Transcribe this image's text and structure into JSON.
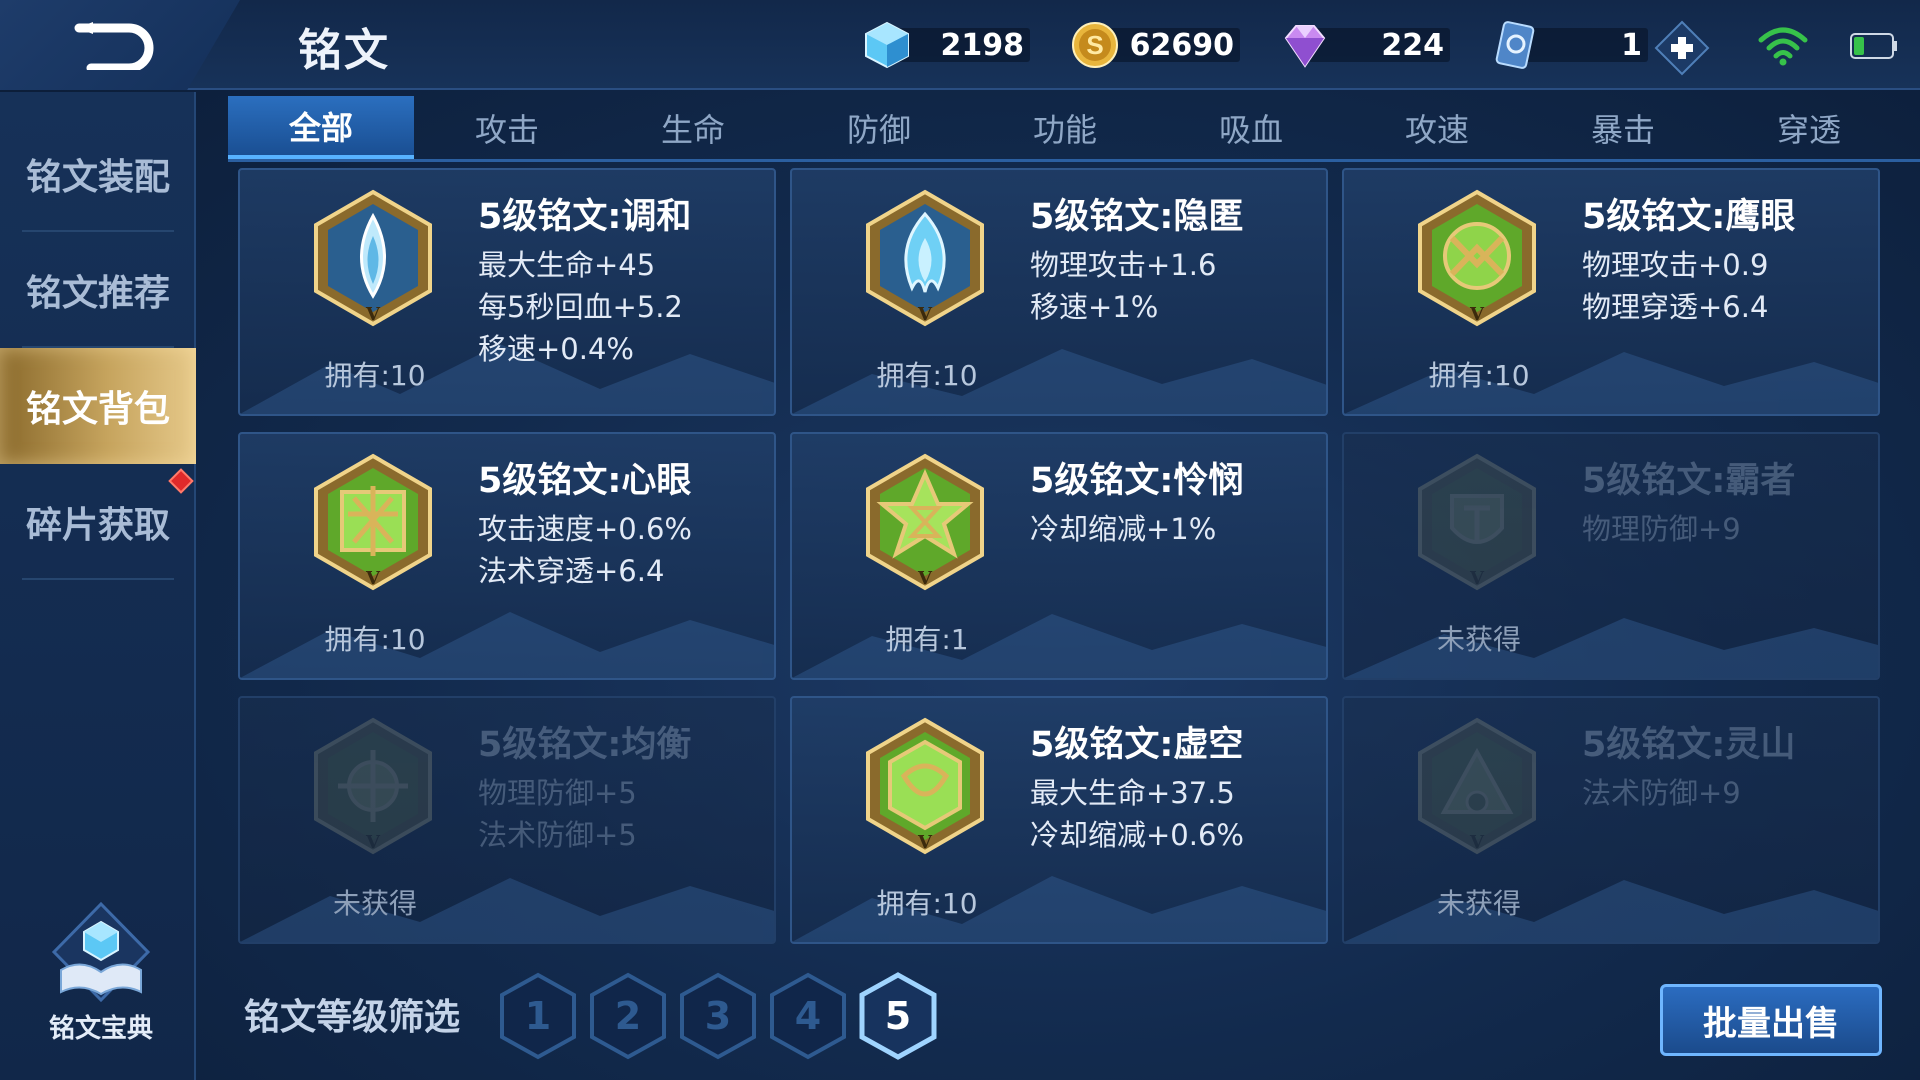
{
  "header": {
    "title": "铭文",
    "currencies": [
      {
        "name": "crystal-icon",
        "value": "2198",
        "color": "#5cc8f5"
      },
      {
        "name": "gold-coin-icon",
        "value": "62690",
        "color": "#e8b53c"
      },
      {
        "name": "diamond-icon",
        "value": "224",
        "color": "#c98af0"
      },
      {
        "name": "ticket-icon",
        "value": "1",
        "color": "#7ab0e8"
      }
    ]
  },
  "sidebar": {
    "items": [
      {
        "label": "铭文装配"
      },
      {
        "label": "铭文推荐"
      },
      {
        "label": "铭文背包",
        "active": true
      },
      {
        "label": "碎片获取"
      }
    ],
    "codex_label": "铭文宝典"
  },
  "tabs": [
    "全部",
    "攻击",
    "生命",
    "防御",
    "功能",
    "吸血",
    "攻速",
    "暴击",
    "穿透"
  ],
  "active_tab": "全部",
  "cards": [
    {
      "name": "5级铭文:调和",
      "stats": [
        "最大生命+45",
        "每5秒回血+5.2",
        "移速+0.4%"
      ],
      "owned": "拥有:10",
      "locked": false,
      "icon": "blue-drop-emblem-icon"
    },
    {
      "name": "5级铭文:隐匿",
      "stats": [
        "物理攻击+1.6",
        "移速+1%"
      ],
      "owned": "拥有:10",
      "locked": false,
      "icon": "blue-flame-emblem-icon"
    },
    {
      "name": "5级铭文:鹰眼",
      "stats": [
        "物理攻击+0.9",
        "物理穿透+6.4"
      ],
      "owned": "拥有:10",
      "locked": false,
      "icon": "green-eagle-emblem-icon"
    },
    {
      "name": "5级铭文:心眼",
      "stats": [
        "攻击速度+0.6%",
        "法术穿透+6.4"
      ],
      "owned": "拥有:10",
      "locked": false,
      "icon": "green-eye-emblem-icon"
    },
    {
      "name": "5级铭文:怜悯",
      "stats": [
        "冷却缩减+1%"
      ],
      "owned": "拥有:1",
      "locked": false,
      "icon": "green-star-emblem-icon"
    },
    {
      "name": "5级铭文:霸者",
      "stats": [
        "物理防御+9"
      ],
      "owned": "未获得",
      "locked": true,
      "icon": "green-helm-emblem-icon"
    },
    {
      "name": "5级铭文:均衡",
      "stats": [
        "物理防御+5",
        "法术防御+5"
      ],
      "owned": "未获得",
      "locked": true,
      "icon": "green-balance-emblem-icon"
    },
    {
      "name": "5级铭文:虚空",
      "stats": [
        "最大生命+37.5",
        "冷却缩减+0.6%"
      ],
      "owned": "拥有:10",
      "locked": false,
      "icon": "green-void-emblem-icon"
    },
    {
      "name": "5级铭文:灵山",
      "stats": [
        "法术防御+9"
      ],
      "owned": "未获得",
      "locked": true,
      "icon": "green-mountain-emblem-icon"
    }
  ],
  "filter": {
    "label": "铭文等级筛选",
    "levels": [
      "1",
      "2",
      "3",
      "4",
      "5"
    ],
    "active_level": "5"
  },
  "sell_button": "批量出售",
  "colors": {
    "accent_blue": "#2b6fbf",
    "gold": "#c6a45e",
    "emblem_green": "#7bc23a",
    "emblem_blue": "#6fc9f0"
  }
}
